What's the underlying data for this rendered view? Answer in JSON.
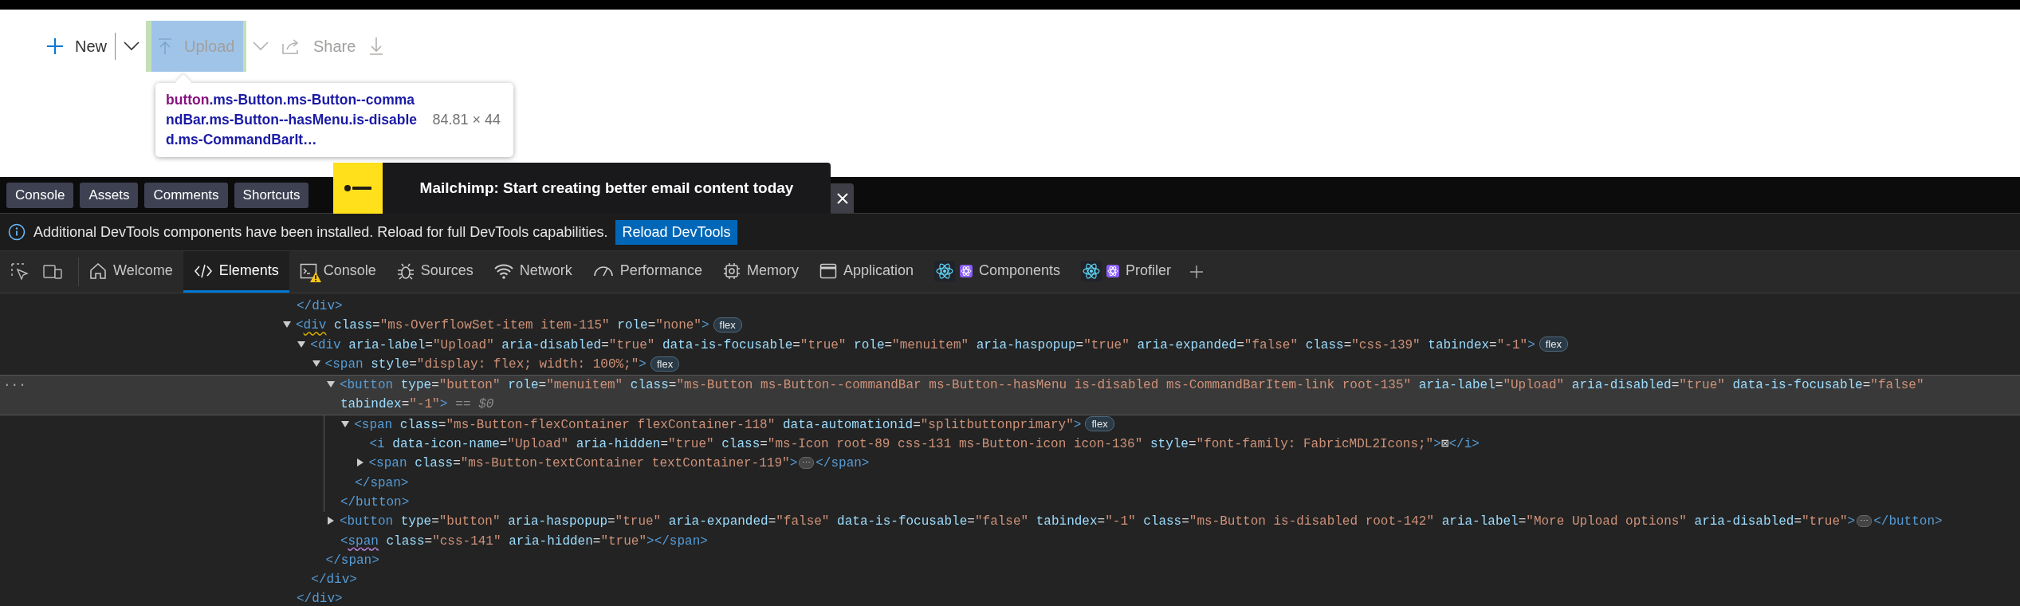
{
  "command_bar": {
    "items": [
      {
        "kind": "add",
        "label": "New",
        "disabled": false,
        "highlighted": false
      },
      {
        "kind": "menu",
        "disabled": false,
        "highlighted": false
      },
      {
        "kind": "upload",
        "label": "Upload",
        "disabled": true,
        "highlighted": true
      },
      {
        "kind": "menu",
        "disabled": true,
        "highlighted": false
      },
      {
        "kind": "share",
        "label": "Share",
        "disabled": true,
        "highlighted": false
      },
      {
        "kind": "download",
        "disabled": true,
        "highlighted": false
      }
    ]
  },
  "inspect_tooltip": {
    "tag": "button",
    "selector": ".ms-Button.ms-Button--commandBar.ms-Button--hasMenu.is-disabled.ms-CommandBarIt…",
    "size": "84.81 × 44"
  },
  "promo_banner": {
    "message": "Mailchimp: Start creating better email content today"
  },
  "devtools": {
    "quick_buttons": [
      "Console",
      "Assets",
      "Comments",
      "Shortcuts"
    ],
    "info_bar": {
      "message": "Additional DevTools components have been installed. Reload for full DevTools capabilities.",
      "action": "Reload DevTools"
    },
    "tools": [
      {
        "kind": "inspect"
      },
      {
        "kind": "device"
      }
    ],
    "tabs": [
      {
        "kind": "welcome",
        "label": "Welcome",
        "selected": false,
        "warning": false
      },
      {
        "kind": "elements",
        "label": "Elements",
        "selected": true,
        "warning": false
      },
      {
        "kind": "console",
        "label": "Console",
        "selected": false,
        "warning": true
      },
      {
        "kind": "sources",
        "label": "Sources",
        "selected": false,
        "warning": false
      },
      {
        "kind": "network",
        "label": "Network",
        "selected": false,
        "warning": false
      },
      {
        "kind": "performance",
        "label": "Performance",
        "selected": false,
        "warning": false
      },
      {
        "kind": "memory",
        "label": "Memory",
        "selected": false,
        "warning": false
      },
      {
        "kind": "application",
        "label": "Application",
        "selected": false,
        "warning": false
      },
      {
        "kind": "react",
        "label": "Components",
        "selected": false,
        "warning": false
      },
      {
        "kind": "react",
        "label": "Profiler",
        "selected": false,
        "warning": false
      }
    ],
    "elements_tree": {
      "nodes": [
        {
          "open": "</div>",
          "selected": false
        },
        {
          "open": "<div class=\"ms-OverflowSet-item item-115\" role=\"none\">",
          "badge": "flex",
          "color": "#cca700",
          "expanded": true,
          "selected": false,
          "children": [
            {
              "open": "<div aria-label=\"Upload\" aria-disabled=\"true\" data-is-focusable=\"true\" role=\"menuitem\" aria-haspopup=\"true\" aria-expanded=\"false\" class=\"css-139\" tabindex=\"-1\">",
              "badge": "flex",
              "expanded": true,
              "selected": false,
              "children": [
                {
                  "open": "<span style=\"display: flex; width: 100%;\">",
                  "badge": "flex",
                  "expanded": true,
                  "selected": false,
                  "children": [
                    {
                      "open": "<button type=\"button\" role=\"menuitem\" class=\"ms-Button ms-Button--commandBar ms-Button--hasMenu is-disabled ms-CommandBarItem-link root-135\" aria-label=\"Upload\" aria-disabled=\"true\" data-is-focusable=\"false\" tabindex=\"-1\">",
                      "note": "== $0",
                      "gutter": "···",
                      "expanded": true,
                      "selected": true,
                      "children": [
                        {
                          "open": "<span class=\"ms-Button-flexContainer flexContainer-118\" data-automationid=\"splitbuttonprimary\">",
                          "badge": "flex",
                          "expanded": true,
                          "selected": false,
                          "children": [
                            {
                              "open": "<i data-icon-name=\"Upload\" aria-hidden=\"true\" class=\"ms-Icon root-89 css-131 ms-Button-icon icon-136\" style=\"font-family: FabricMDL2Icons;\">⊠</i>",
                              "selected": false
                            },
                            {
                              "open": "<span class=\"ms-Button-textContainer textContainer-119\">",
                              "ellipsis": "⋯",
                              "close": "</span>",
                              "expanded": false,
                              "selected": false
                            }
                          ],
                          "close": "</span>"
                        }
                      ],
                      "close": "</button>"
                    },
                    {
                      "open": "<button type=\"button\" aria-haspopup=\"true\" aria-expanded=\"false\" data-is-focusable=\"false\" tabindex=\"-1\" class=\"ms-Button is-disabled root-142\" aria-label=\"More Upload options\" aria-disabled=\"true\">",
                      "ellipsis": "⋯",
                      "close": "</button>",
                      "expanded": false,
                      "selected": false
                    },
                    {
                      "open": "<span class=\"css-141\" aria-hidden=\"true\"></span>",
                      "color": "#b180d7",
                      "selected": false
                    }
                  ],
                  "close": "</span>"
                }
              ],
              "close": "</div>"
            }
          ],
          "close": "</div>"
        }
      ]
    }
  }
}
